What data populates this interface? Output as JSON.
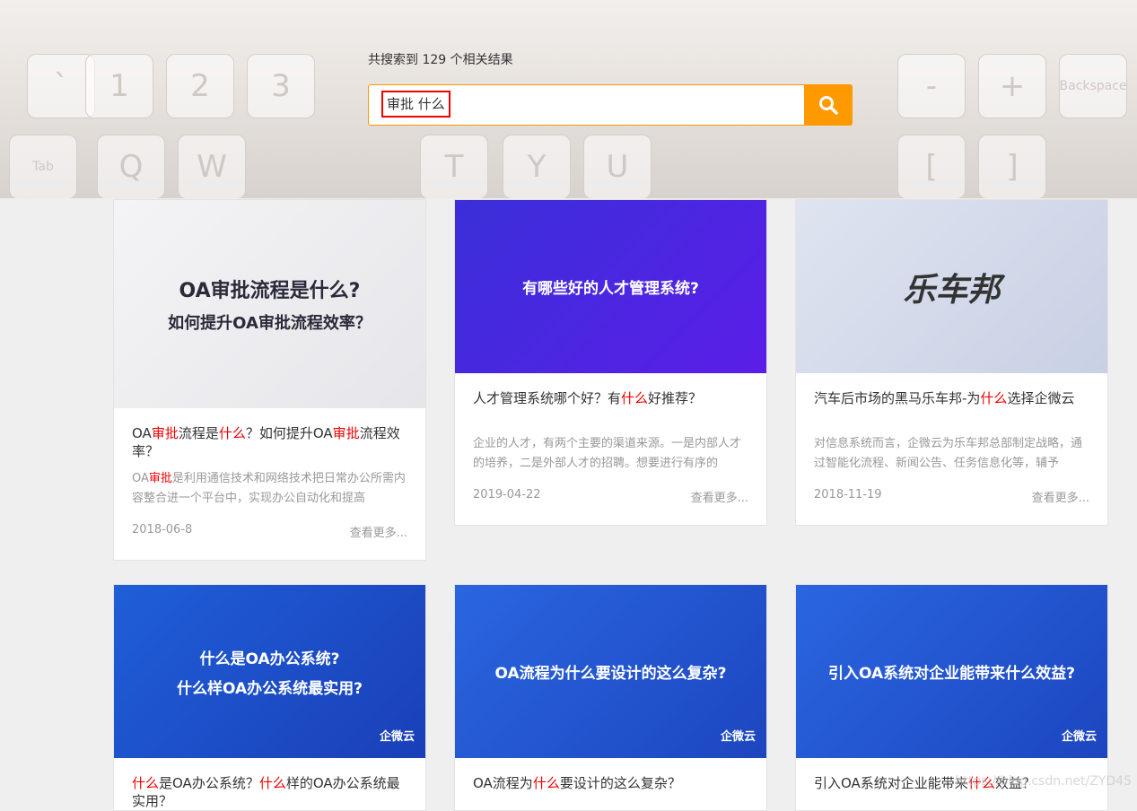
{
  "search": {
    "result_count_text": "共搜索到 129 个相关结果",
    "query": "审批 什么",
    "search_icon": "search-icon"
  },
  "hero_keys": [
    "`",
    "1",
    "2",
    "3",
    "Q",
    "W",
    "Tab",
    "T",
    "Y",
    "U",
    "-",
    "+",
    "Backspace",
    "[",
    "]"
  ],
  "cards": [
    {
      "image_text": [
        "OA审批流程是什么?",
        "如何提升OA审批流程效率？"
      ],
      "title": [
        {
          "t": "OA"
        },
        {
          "t": "审批",
          "hl": true
        },
        {
          "t": "流程是"
        },
        {
          "t": "什么",
          "hl": true
        },
        {
          "t": "？如何提升OA"
        },
        {
          "t": "审批",
          "hl": true
        },
        {
          "t": "流程效率？"
        }
      ],
      "desc": [
        {
          "t": "OA"
        },
        {
          "t": "审批",
          "hl": true
        },
        {
          "t": "是利用通信技术和网络技术把日常办公所需内容整合进一个平台中，实现办公自动化和提高"
        }
      ],
      "date": "2018-06-8",
      "more": "查看更多..."
    },
    {
      "image_text": [
        "有哪些好的人才管理系统?"
      ],
      "title": [
        {
          "t": "人才管理系统哪个好？有"
        },
        {
          "t": "什么",
          "hl": true
        },
        {
          "t": "好推荐？"
        }
      ],
      "desc": [
        {
          "t": "企业的人才，有两个主要的渠道来源。一是内部人才的培养，二是外部人才的招聘。想要进行有序的"
        }
      ],
      "date": "2019-04-22",
      "more": "查看更多..."
    },
    {
      "image_text": [
        "乐车邦"
      ],
      "title": [
        {
          "t": "汽车后市场的黑马乐车邦-为"
        },
        {
          "t": "什么",
          "hl": true
        },
        {
          "t": "选择企微云"
        }
      ],
      "desc": [
        {
          "t": "对信息系统而言，企微云为乐车邦总部制定战略，通过智能化流程、新闻公告、任务信息化等，辅予"
        }
      ],
      "date": "2018-11-19",
      "more": "查看更多..."
    },
    {
      "image_text": [
        "什么是OA办公系统?",
        "什么样OA办公系统最实用?",
        "企微云"
      ],
      "title": [
        {
          "t": "什么",
          "hl": true
        },
        {
          "t": "是OA办公系统？"
        },
        {
          "t": "什么",
          "hl": true
        },
        {
          "t": "样的OA办公系统最实用？"
        }
      ]
    },
    {
      "image_text": [
        "OA流程为什么要设计的这么复杂?",
        "企微云"
      ],
      "title": [
        {
          "t": "OA流程为"
        },
        {
          "t": "什么",
          "hl": true
        },
        {
          "t": "要设计的这么复杂？"
        }
      ]
    },
    {
      "image_text": [
        "引入OA系统对企业能带来什么效益?",
        "企微云"
      ],
      "title": [
        {
          "t": "引入OA系统对企业能带来"
        },
        {
          "t": "什么",
          "hl": true
        },
        {
          "t": "效益？"
        }
      ]
    }
  ],
  "watermark": "https://blog.csdn.net/ZYD45",
  "colors": {
    "accent": "#ff9900",
    "highlight": "#ee0000"
  }
}
